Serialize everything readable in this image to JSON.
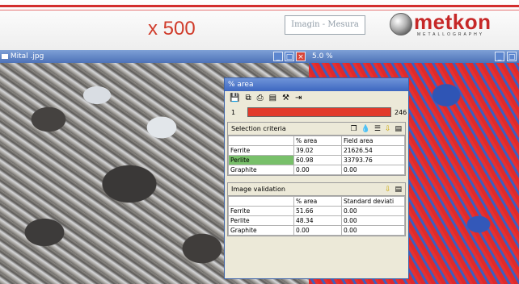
{
  "banner": {
    "magnification": "x 500",
    "imagin_box": "Imagin - Mesura",
    "logo_name": "metkon",
    "logo_subtitle": "METALLOGRAPHY",
    "accent_color": "#d32f2f"
  },
  "left_window": {
    "title": "Mital .jpg",
    "buttons": [
      "minimize",
      "maximize",
      "close"
    ]
  },
  "right_window": {
    "title": "5.0 %",
    "buttons": [
      "minimize",
      "maximize"
    ]
  },
  "dialog": {
    "title": "% area",
    "toolbar_icons": [
      "save-icon",
      "copy-icon",
      "print-icon",
      "sheet-icon",
      "tools-icon",
      "exit-icon"
    ],
    "progress": {
      "label": "1",
      "value": "246",
      "fill_color": "#e23a2b"
    },
    "selection_criteria": {
      "label": "Selection criteria",
      "icons": [
        "layers-icon",
        "drop-icon",
        "list-icon",
        "arrow-down-icon",
        "sheet-icon"
      ],
      "headers": [
        "",
        "% area",
        "Field area"
      ],
      "rows": [
        {
          "name": "Ferrite",
          "area": "39.02",
          "field": "21626.54"
        },
        {
          "name": "Perlite",
          "area": "60.98",
          "field": "33793.76"
        },
        {
          "name": "Graphite",
          "area": "0.00",
          "field": "0.00"
        }
      ],
      "highlight_color": "#78c06a"
    },
    "image_validation": {
      "label": "Image validation",
      "icons": [
        "arrow-down-icon",
        "sheet-icon"
      ],
      "headers": [
        "",
        "% area",
        "Standard deviati"
      ],
      "rows": [
        {
          "name": "Ferrite",
          "area": "51.66",
          "dev": "0.00"
        },
        {
          "name": "Perlite",
          "area": "48.34",
          "dev": "0.00"
        },
        {
          "name": "Graphite",
          "area": "0.00",
          "dev": "0.00"
        }
      ]
    }
  }
}
